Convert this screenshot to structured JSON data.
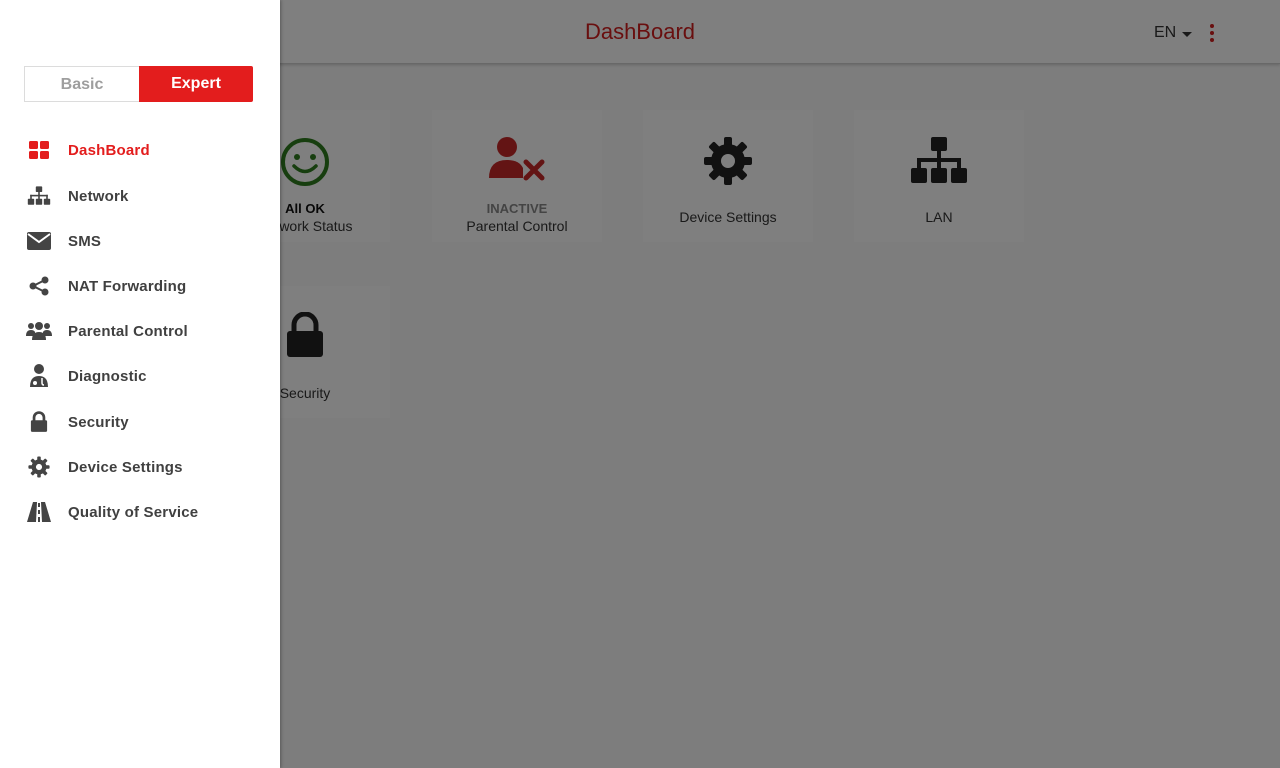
{
  "header": {
    "title": "DashBoard",
    "language": "EN"
  },
  "tiles": [
    {
      "status": "All OK",
      "label": "Network Status",
      "icon": "smiley-icon",
      "status_color": "#111111",
      "icon_color": "#2e7d1e"
    },
    {
      "status": "INACTIVE",
      "label": "Parental Control",
      "icon": "user-blocked-icon",
      "status_color": "#888888",
      "icon_color": "#c62828"
    },
    {
      "label": "Device Settings",
      "icon": "gear-icon"
    },
    {
      "label": "LAN",
      "icon": "sitemap-icon"
    },
    {
      "label": "Security",
      "icon": "lock-icon"
    }
  ],
  "drawer": {
    "mode": {
      "basic_label": "Basic",
      "expert_label": "Expert",
      "selected": "Expert"
    },
    "nav": [
      {
        "label": "DashBoard",
        "icon": "dashboard-grid-icon",
        "active": true
      },
      {
        "label": "Network",
        "icon": "sitemap-icon"
      },
      {
        "label": "SMS",
        "icon": "envelope-icon"
      },
      {
        "label": "NAT Forwarding",
        "icon": "share-icon"
      },
      {
        "label": "Parental Control",
        "icon": "users-icon"
      },
      {
        "label": "Diagnostic",
        "icon": "doctor-icon"
      },
      {
        "label": "Security",
        "icon": "lock-icon"
      },
      {
        "label": "Device Settings",
        "icon": "gear-icon"
      },
      {
        "label": "Quality of Service",
        "icon": "road-icon"
      }
    ]
  },
  "colors": {
    "accent": "#e31d1d",
    "overlay": "rgba(0,0,0,0.5)"
  }
}
